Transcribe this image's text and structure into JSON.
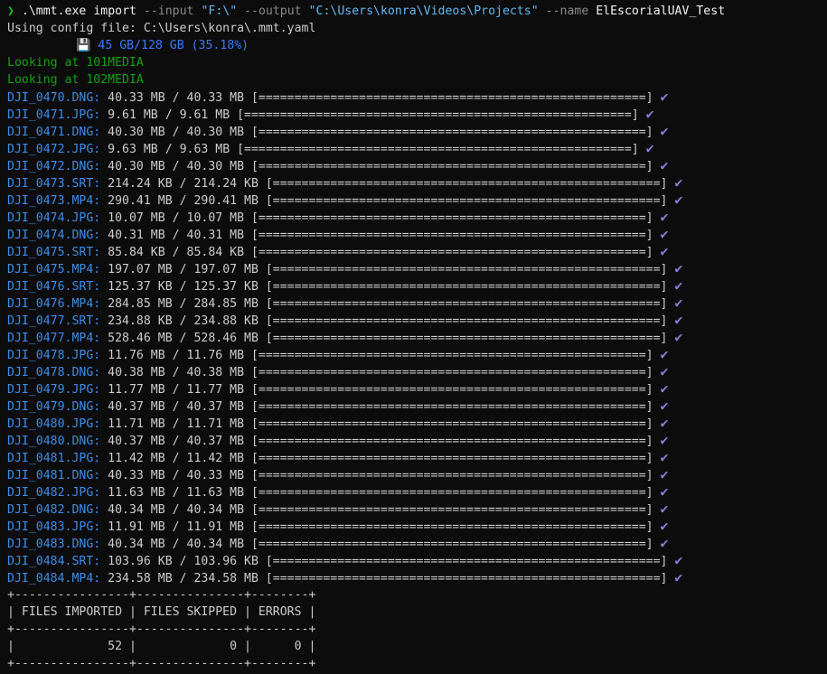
{
  "command": {
    "prompt": "❯",
    "exe": ".\\mmt.exe",
    "subcommand": "import",
    "input_flag": "--input",
    "input_value": "\"F:\\\"",
    "output_flag": "--output",
    "output_value": "\"C:\\Users\\konra\\Videos\\Projects\"",
    "name_flag": "--name",
    "name_value": "ElEscorialUAV_Test"
  },
  "config_line": "Using config file: C:\\Users\\konra\\.mmt.yaml",
  "drive": {
    "icon": "💾",
    "usage": "45 GB/128 GB (35.18%)"
  },
  "looking": [
    "Looking at 101MEDIA",
    "Looking at 102MEDIA"
  ],
  "files": [
    {
      "name": "DJI_0470.DNG:",
      "progress": "40.33 MB / 40.33 MB [======================================================]",
      "check": "✔"
    },
    {
      "name": "DJI_0471.JPG:",
      "progress": "9.61 MB / 9.61 MB [======================================================]",
      "check": "✔"
    },
    {
      "name": "DJI_0471.DNG:",
      "progress": "40.30 MB / 40.30 MB [======================================================]",
      "check": "✔"
    },
    {
      "name": "DJI_0472.JPG:",
      "progress": "9.63 MB / 9.63 MB [======================================================]",
      "check": "✔"
    },
    {
      "name": "DJI_0472.DNG:",
      "progress": "40.30 MB / 40.30 MB [======================================================]",
      "check": "✔"
    },
    {
      "name": "DJI_0473.SRT:",
      "progress": "214.24 KB / 214.24 KB [======================================================]",
      "check": "✔"
    },
    {
      "name": "DJI_0473.MP4:",
      "progress": "290.41 MB / 290.41 MB [======================================================]",
      "check": "✔"
    },
    {
      "name": "DJI_0474.JPG:",
      "progress": "10.07 MB / 10.07 MB [======================================================]",
      "check": "✔"
    },
    {
      "name": "DJI_0474.DNG:",
      "progress": "40.31 MB / 40.31 MB [======================================================]",
      "check": "✔"
    },
    {
      "name": "DJI_0475.SRT:",
      "progress": "85.84 KB / 85.84 KB [======================================================]",
      "check": "✔"
    },
    {
      "name": "DJI_0475.MP4:",
      "progress": "197.07 MB / 197.07 MB [======================================================]",
      "check": "✔"
    },
    {
      "name": "DJI_0476.SRT:",
      "progress": "125.37 KB / 125.37 KB [======================================================]",
      "check": "✔"
    },
    {
      "name": "DJI_0476.MP4:",
      "progress": "284.85 MB / 284.85 MB [======================================================]",
      "check": "✔"
    },
    {
      "name": "DJI_0477.SRT:",
      "progress": "234.88 KB / 234.88 KB [======================================================]",
      "check": "✔"
    },
    {
      "name": "DJI_0477.MP4:",
      "progress": "528.46 MB / 528.46 MB [======================================================]",
      "check": "✔"
    },
    {
      "name": "DJI_0478.JPG:",
      "progress": "11.76 MB / 11.76 MB [======================================================]",
      "check": "✔"
    },
    {
      "name": "DJI_0478.DNG:",
      "progress": "40.38 MB / 40.38 MB [======================================================]",
      "check": "✔"
    },
    {
      "name": "DJI_0479.JPG:",
      "progress": "11.77 MB / 11.77 MB [======================================================]",
      "check": "✔"
    },
    {
      "name": "DJI_0479.DNG:",
      "progress": "40.37 MB / 40.37 MB [======================================================]",
      "check": "✔"
    },
    {
      "name": "DJI_0480.JPG:",
      "progress": "11.71 MB / 11.71 MB [======================================================]",
      "check": "✔"
    },
    {
      "name": "DJI_0480.DNG:",
      "progress": "40.37 MB / 40.37 MB [======================================================]",
      "check": "✔"
    },
    {
      "name": "DJI_0481.JPG:",
      "progress": "11.42 MB / 11.42 MB [======================================================]",
      "check": "✔"
    },
    {
      "name": "DJI_0481.DNG:",
      "progress": "40.33 MB / 40.33 MB [======================================================]",
      "check": "✔"
    },
    {
      "name": "DJI_0482.JPG:",
      "progress": "11.63 MB / 11.63 MB [======================================================]",
      "check": "✔"
    },
    {
      "name": "DJI_0482.DNG:",
      "progress": "40.34 MB / 40.34 MB [======================================================]",
      "check": "✔"
    },
    {
      "name": "DJI_0483.JPG:",
      "progress": "11.91 MB / 11.91 MB [======================================================]",
      "check": "✔"
    },
    {
      "name": "DJI_0483.DNG:",
      "progress": "40.34 MB / 40.34 MB [======================================================]",
      "check": "✔"
    },
    {
      "name": "DJI_0484.SRT:",
      "progress": "103.96 KB / 103.96 KB [======================================================]",
      "check": "✔"
    },
    {
      "name": "DJI_0484.MP4:",
      "progress": "234.58 MB / 234.58 MB [======================================================]",
      "check": "✔"
    }
  ],
  "summary_table": [
    "+----------------+---------------+--------+",
    "| FILES IMPORTED | FILES SKIPPED | ERRORS |",
    "+----------------+---------------+--------+",
    "|             52 |             0 |      0 |",
    "+----------------+---------------+--------+"
  ],
  "summary": {
    "headers": [
      "FILES IMPORTED",
      "FILES SKIPPED",
      "ERRORS"
    ],
    "values": [
      52,
      0,
      0
    ]
  },
  "colors": {
    "background": "#0c0c0c",
    "text": "#cccccc",
    "prompt": "#16c60c",
    "string": "#61b8f2",
    "flag": "#8a8a8a",
    "looking": "#13a10e",
    "filename": "#3b8eea",
    "check": "#8a7dd6"
  }
}
